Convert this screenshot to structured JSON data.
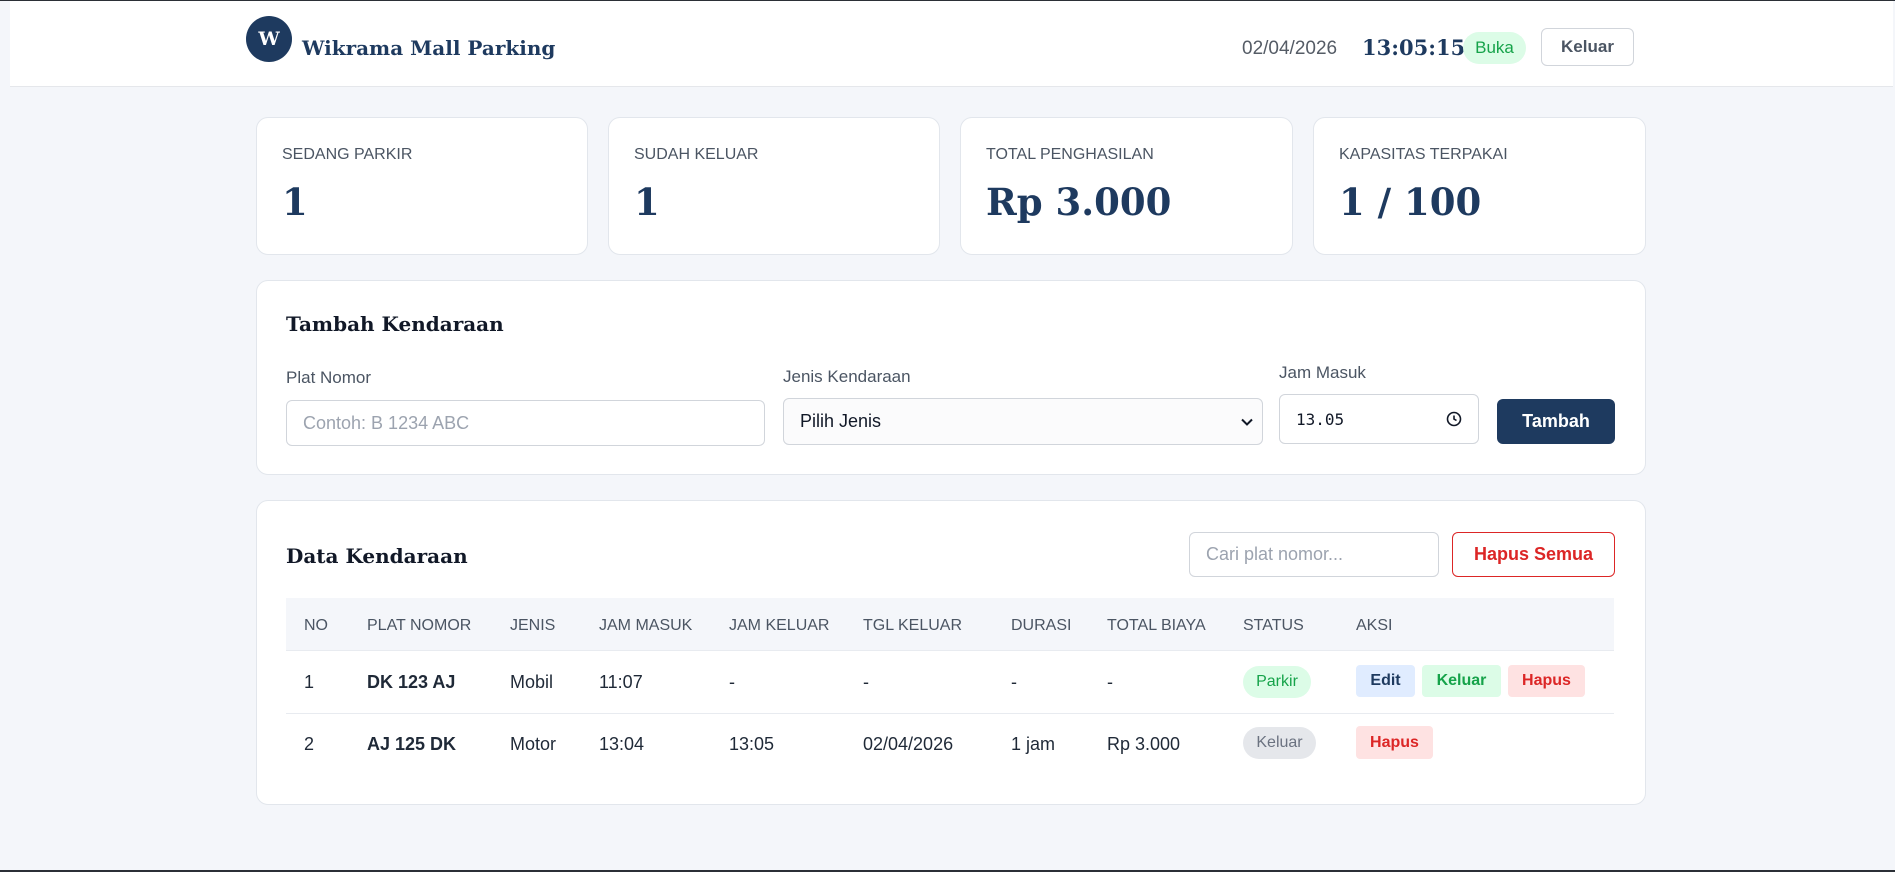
{
  "header": {
    "logo_letter": "W",
    "brand": "Wikrama Mall Parking",
    "date": "02/04/2026",
    "time": "13:05:15",
    "status": "Buka",
    "logout_label": "Keluar"
  },
  "stats": [
    {
      "label": "SEDANG PARKIR",
      "value": "1"
    },
    {
      "label": "SUDAH KELUAR",
      "value": "1"
    },
    {
      "label": "TOTAL PENGHASILAN",
      "value": "Rp 3.000"
    },
    {
      "label": "KAPASITAS TERPAKAI",
      "value": "1 / 100"
    }
  ],
  "form": {
    "title": "Tambah Kendaraan",
    "plate_label": "Plat Nomor",
    "plate_placeholder": "Contoh: B 1234 ABC",
    "type_label": "Jenis Kendaraan",
    "type_selected": "Pilih Jenis",
    "time_label": "Jam Masuk",
    "time_value": "13.05",
    "submit_label": "Tambah"
  },
  "table": {
    "title": "Data Kendaraan",
    "search_placeholder": "Cari plat nomor...",
    "clear_all_label": "Hapus Semua",
    "columns": [
      "NO",
      "PLAT NOMOR",
      "JENIS",
      "JAM MASUK",
      "JAM KELUAR",
      "TGL KELUAR",
      "DURASI",
      "TOTAL BIAYA",
      "STATUS",
      "AKSI"
    ],
    "rows": [
      {
        "no": "1",
        "plate": "DK 123 AJ",
        "type": "Mobil",
        "in": "11:07",
        "out": "-",
        "date_out": "-",
        "duration": "-",
        "total": "-",
        "status": "Parkir",
        "actions": [
          "Edit",
          "Keluar",
          "Hapus"
        ]
      },
      {
        "no": "2",
        "plate": "AJ 125 DK",
        "type": "Motor",
        "in": "13:04",
        "out": "13:05",
        "date_out": "02/04/2026",
        "duration": "1 jam",
        "total": "Rp 3.000",
        "status": "Keluar",
        "actions": [
          "Hapus"
        ]
      }
    ]
  },
  "colors": {
    "primary": "#1e3a5f",
    "success_bg": "#dcfce7",
    "success_text": "#16a34a",
    "danger": "#dc2626",
    "danger_bg": "#fee2e2",
    "info_bg": "#e0ecff",
    "neutral_bg": "#e5e7eb"
  },
  "icons": {
    "select_arrow": "chevron-down-icon",
    "time_picker": "clock-icon"
  }
}
